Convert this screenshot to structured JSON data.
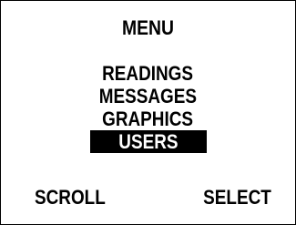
{
  "screen": {
    "title": "MENU",
    "menu": {
      "items": [
        {
          "label": "READINGS",
          "selected": false
        },
        {
          "label": "MESSAGES",
          "selected": false
        },
        {
          "label": "GRAPHICS",
          "selected": false
        },
        {
          "label": "USERS",
          "selected": true
        }
      ]
    },
    "softkeys": {
      "left": "SCROLL",
      "right": "SELECT"
    }
  },
  "colors": {
    "background": "#ffffff",
    "foreground": "#000000",
    "highlight_background": "#000000",
    "highlight_foreground": "#ffffff"
  }
}
